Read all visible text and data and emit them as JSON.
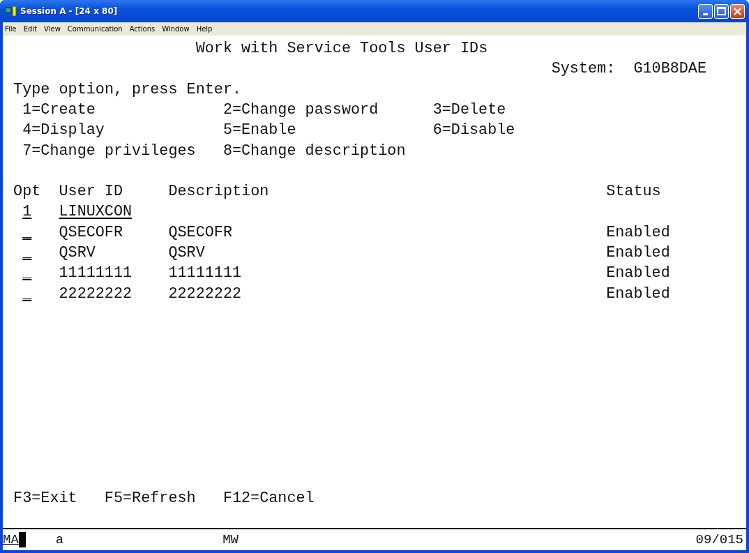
{
  "window": {
    "title": "Session A - [24 x 80]"
  },
  "menu": [
    "File",
    "Edit",
    "View",
    "Communication",
    "Actions",
    "Window",
    "Help"
  ],
  "screen": {
    "title": "Work with Service Tools User IDs",
    "system_label": "System:",
    "system_value": "G10B8DAE",
    "instruction": "Type option, press Enter.",
    "options": [
      "1=Create",
      "2=Change password",
      "3=Delete",
      "4=Display",
      "5=Enable",
      "6=Disable",
      "7=Change privileges",
      "8=Change description"
    ],
    "columns": [
      "Opt",
      "User ID",
      "Description",
      "Status"
    ],
    "rows": [
      {
        "kind": "new",
        "opt": "1",
        "user_id": "LINUXCON"
      },
      {
        "kind": "entry",
        "opt": "_",
        "user_id": "QSECOFR",
        "description": "QSECOFR",
        "status": "Enabled"
      },
      {
        "kind": "entry",
        "opt": "_",
        "user_id": "QSRV",
        "description": "QSRV",
        "status": "Enabled"
      },
      {
        "kind": "entry",
        "opt": "_",
        "user_id": "11111111",
        "description": "11111111",
        "status": "Enabled"
      },
      {
        "kind": "entry",
        "opt": "_",
        "user_id": "22222222",
        "description": "22222222",
        "status": "Enabled"
      }
    ],
    "function_keys": [
      "F3=Exit",
      "F5=Refresh",
      "F12=Cancel"
    ]
  },
  "status_bar": {
    "indicator": "MA",
    "field_2": "a",
    "field_3": "MW",
    "cursor_position": "09/015"
  }
}
